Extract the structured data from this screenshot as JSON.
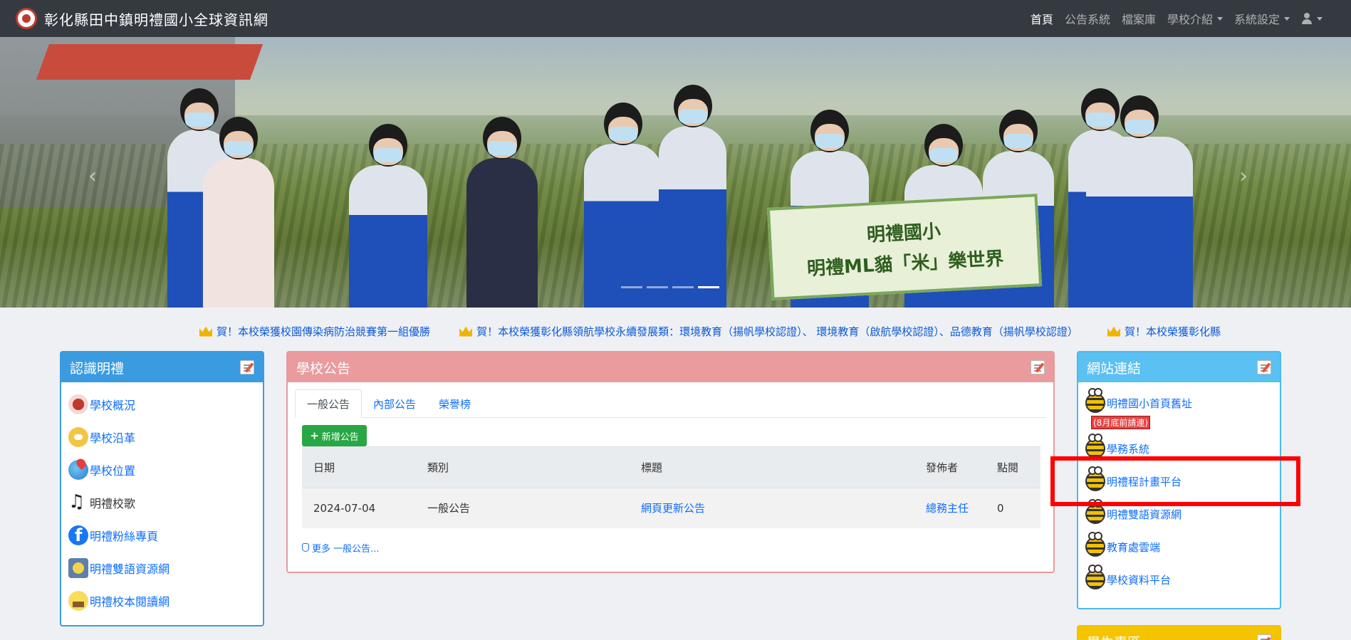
{
  "navbar": {
    "title": "彰化縣田中鎮明禮國小全球資訊網",
    "links": [
      {
        "label": "首頁",
        "active": true,
        "dropdown": false
      },
      {
        "label": "公告系統",
        "active": false,
        "dropdown": false
      },
      {
        "label": "檔案庫",
        "active": false,
        "dropdown": false
      },
      {
        "label": "學校介紹",
        "active": false,
        "dropdown": true
      },
      {
        "label": "系統設定",
        "active": false,
        "dropdown": true
      }
    ],
    "user_icon": "user-icon"
  },
  "hero": {
    "sign_line1": "明禮國小",
    "sign_line2": "明禮ML貓「米」樂世界",
    "indicators": 4,
    "active_indicator": 3
  },
  "marquee": {
    "items": [
      "賀！本校榮獲校園傳染病防治競賽第一組優勝",
      "賀！本校榮獲彰化縣領航學校永續發展類：環境教育（揚帆學校認證）、 環境教育（啟航學校認證）、品德教育（揚帆學校認證）",
      "賀！本校榮獲彰化縣"
    ]
  },
  "about": {
    "title": "認識明禮",
    "items": [
      {
        "label": "學校概況",
        "icon": "school-logo-icon"
      },
      {
        "label": "學校沿革",
        "icon": "chat-icon"
      },
      {
        "label": "學校位置",
        "icon": "map-pin-icon"
      },
      {
        "label": "明禮校歌",
        "icon": "music-note-icon"
      },
      {
        "label": "明禮粉絲專頁",
        "icon": "facebook-icon"
      },
      {
        "label": "明禮雙語資源網",
        "icon": "language-icon"
      },
      {
        "label": "明禮校本閱讀網",
        "icon": "reading-icon"
      }
    ]
  },
  "news": {
    "title": "學校公告",
    "tabs": [
      "一般公告",
      "內部公告",
      "榮譽榜"
    ],
    "add_button": "新增公告",
    "columns": [
      "日期",
      "類別",
      "標題",
      "發佈者",
      "點閱"
    ],
    "rows": [
      {
        "date": "2024-07-04",
        "category": "一般公告",
        "title": "網頁更新公告",
        "author": "總務主任",
        "views": "0"
      }
    ],
    "more": "更多 一般公告..."
  },
  "links": {
    "title": "網站連結",
    "items": [
      {
        "label": "明禮國小首頁舊址",
        "note": "(8月底前請連)"
      },
      {
        "label": "學務系統"
      },
      {
        "label": "明禮程計畫平台"
      },
      {
        "label": "明禮雙語資源網"
      },
      {
        "label": "教育處雲端"
      },
      {
        "label": "學校資料平台"
      }
    ]
  },
  "student": {
    "title": "學生專區"
  },
  "colors": {
    "navbar": "#343a40",
    "about_header": "#3b9be0",
    "news_header": "#ea9b9d",
    "links_header": "#5bc0f2",
    "student_header": "#f5c400",
    "link": "#0d6efd",
    "add_button": "#28a745",
    "highlight": "#ff0000"
  }
}
